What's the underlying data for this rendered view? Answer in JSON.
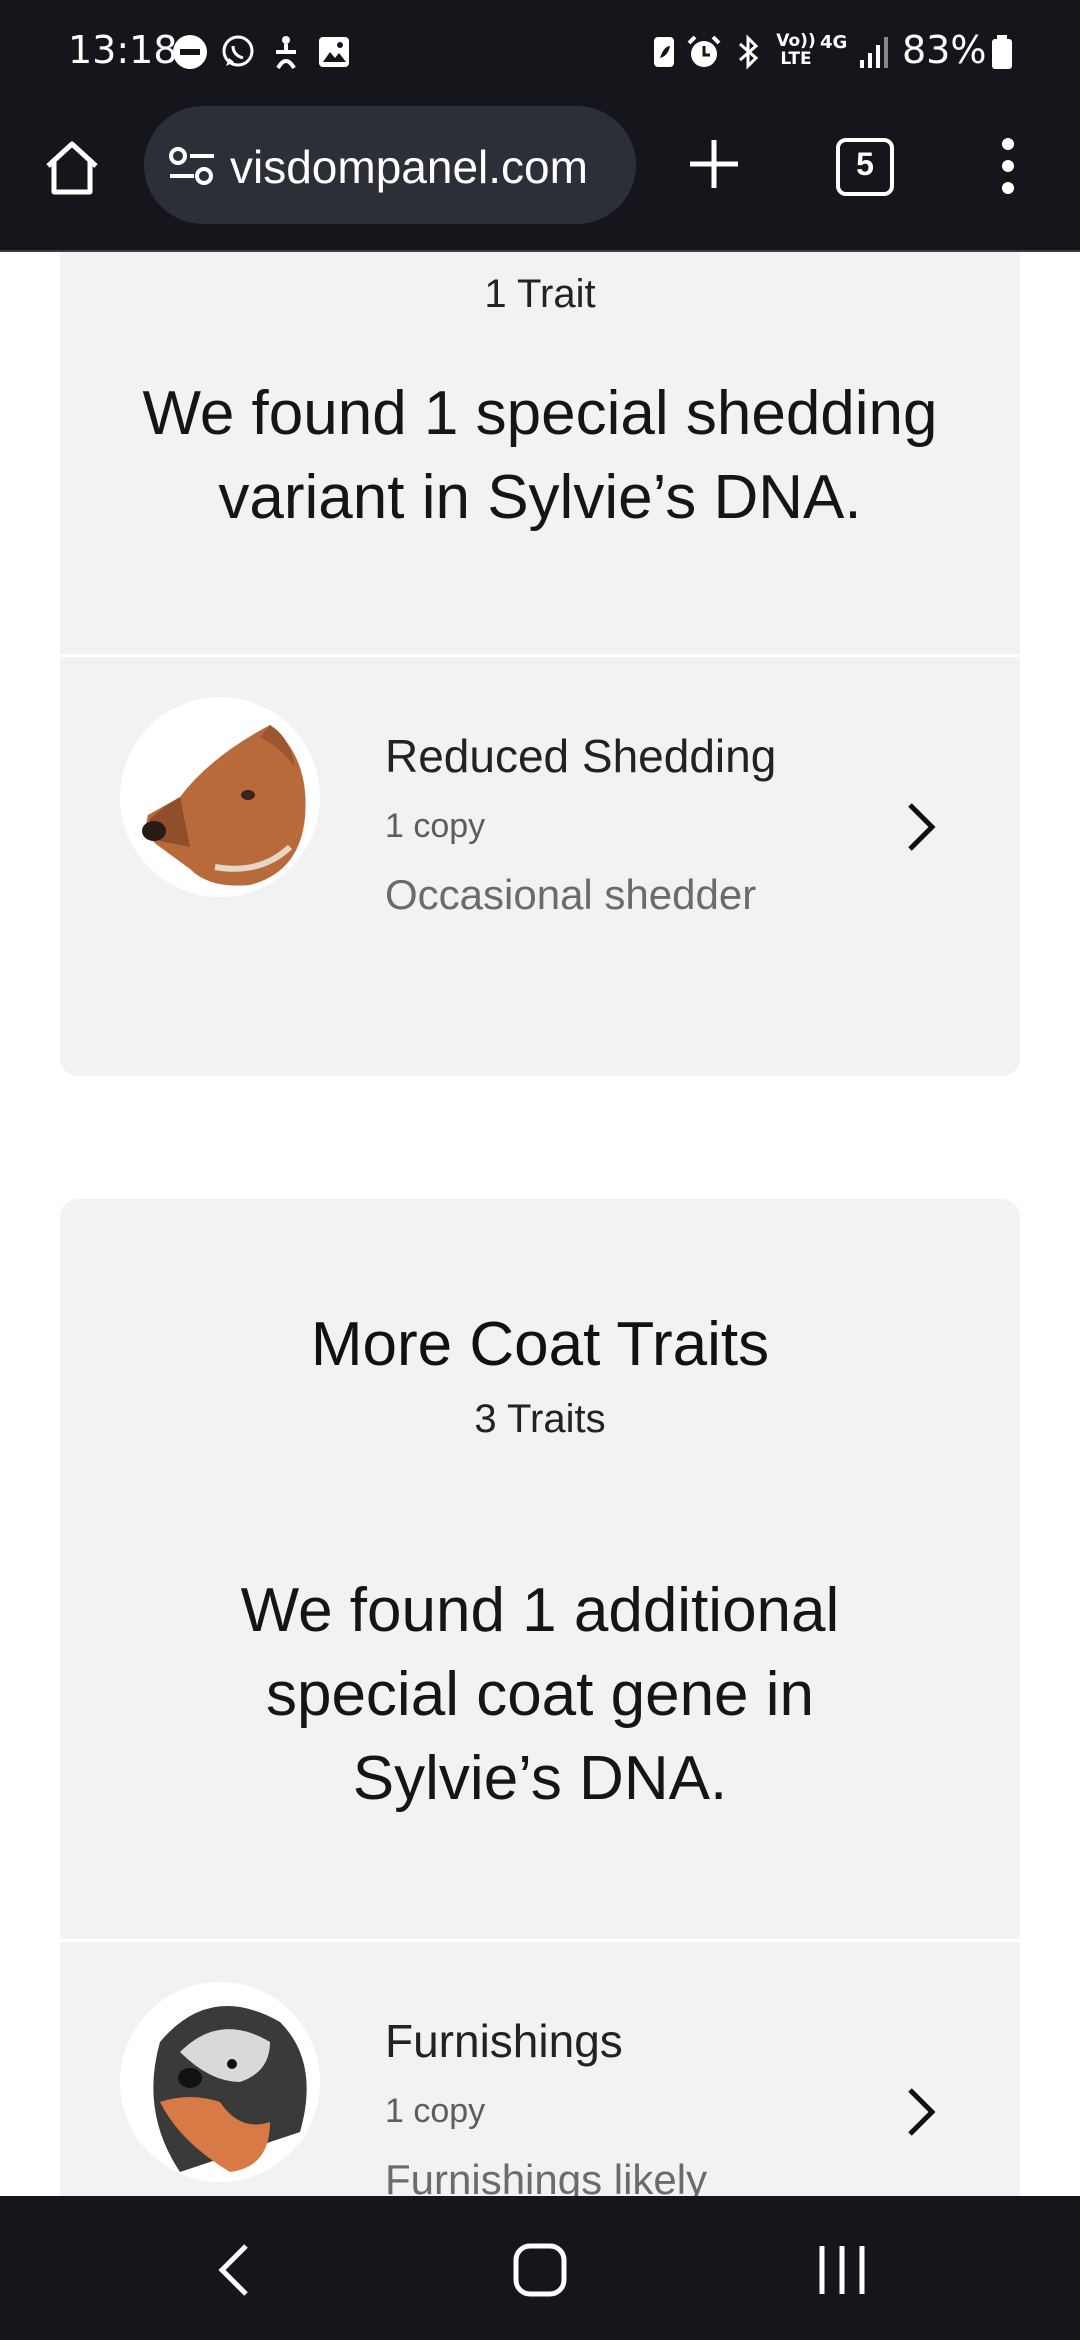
{
  "status_bar": {
    "time": "13:18",
    "battery": "83%",
    "icons": [
      "do-not-disturb-icon",
      "whatsapp-icon",
      "accessibility-icon",
      "gallery-icon",
      "battery-saver-icon",
      "alarm-icon",
      "bluetooth-icon",
      "volte-icon",
      "4g-icon",
      "signal-icon",
      "battery-icon"
    ],
    "volte_label": "Vo)) LTE",
    "network_label": "4G"
  },
  "browser": {
    "url": "visdompanel.com",
    "tab_count": "5"
  },
  "cards": {
    "shedding": {
      "traits_count": "1 Trait",
      "summary": "We found 1 special shedding variant in Sylvie’s DNA.",
      "trait": {
        "name": "Reduced Shedding",
        "copies": "1 copy",
        "description": "Occasional shedder"
      }
    },
    "coat": {
      "title": "More Coat Traits",
      "traits_count": "3 Traits",
      "summary": "We found 1 additional special coat gene in Sylvie’s DNA.",
      "trait": {
        "name": "Furnishings",
        "copies": "1 copy",
        "description": "Furnishings likely"
      }
    }
  },
  "colors": {
    "system_bar": "#14161c",
    "card_bg": "#f2f2f2",
    "url_pill": "#2c2f37"
  }
}
